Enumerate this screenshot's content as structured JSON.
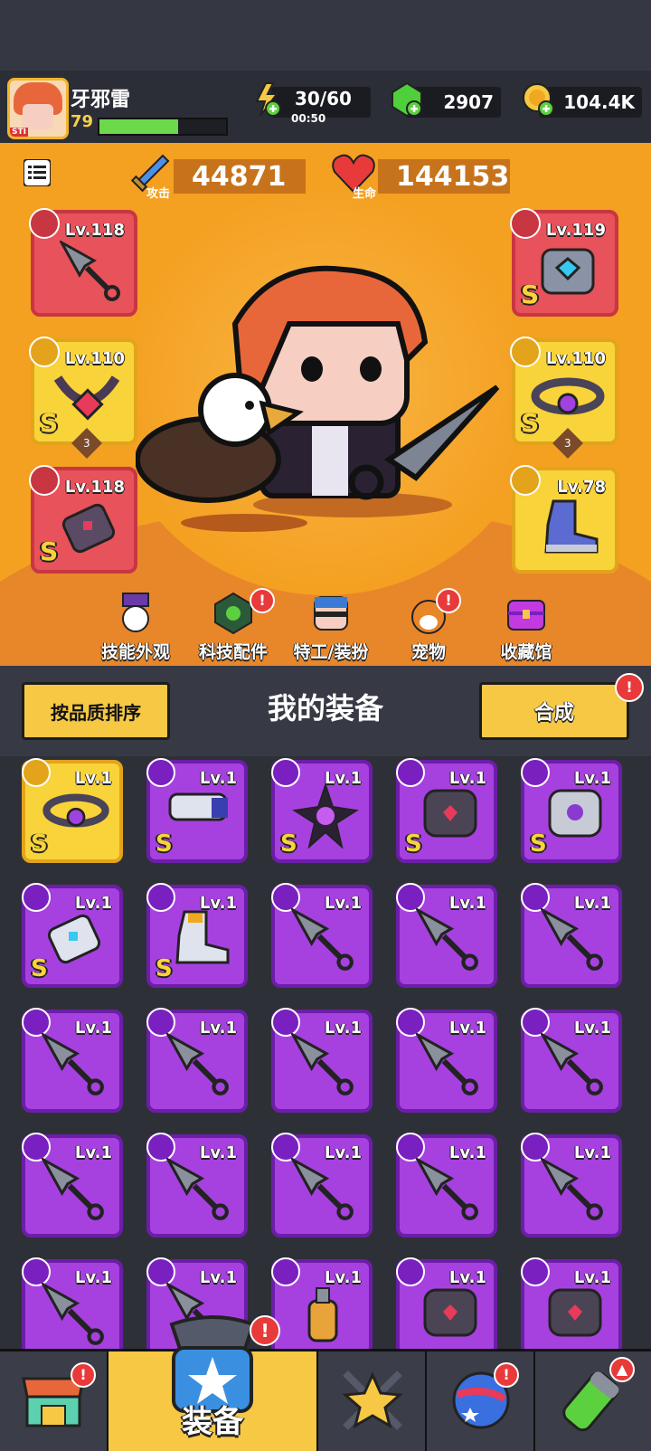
{
  "player": {
    "name": "牙邪雷",
    "level": "79",
    "avatar_tag": "STI",
    "xp_progress": 0.62
  },
  "resources": {
    "energy": "30/60",
    "energy_timer": "00:50",
    "gems": "2907",
    "coins": "104.4K"
  },
  "stats": {
    "attack_label": "攻击",
    "attack_value": "44871",
    "hp_label": "生命",
    "hp_value": "144153"
  },
  "equipped": {
    "left": [
      {
        "lv": "Lv.118",
        "rank": "",
        "stars": ""
      },
      {
        "lv": "Lv.110",
        "rank": "S",
        "stars": "3"
      },
      {
        "lv": "Lv.118",
        "rank": "S",
        "stars": ""
      }
    ],
    "right": [
      {
        "lv": "Lv.119",
        "rank": "S",
        "stars": ""
      },
      {
        "lv": "Lv.110",
        "rank": "S",
        "stars": "3"
      },
      {
        "lv": "Lv.78",
        "rank": "",
        "stars": ""
      }
    ]
  },
  "hero_menu": [
    {
      "label": "技能外观",
      "badge": ""
    },
    {
      "label": "科技配件",
      "badge": "!"
    },
    {
      "label": "特工/装扮",
      "badge": ""
    },
    {
      "label": "宠物",
      "badge": "!"
    },
    {
      "label": "收藏馆",
      "badge": ""
    }
  ],
  "equipment_panel": {
    "title": "我的装备",
    "sort_label": "按品质排序",
    "merge_label": "合成",
    "merge_badge": "!"
  },
  "inventory_level": "Lv.1",
  "inventory_rank": "S",
  "bottom_nav": {
    "equip_label": "装备",
    "badge": "!"
  },
  "colors": {
    "hero_bg": "#f4a021",
    "purple_item": "#a641e0",
    "gold_item": "#f9d33a",
    "red_slot": "#e8525a",
    "button_yellow": "#f7c843",
    "badge_red": "#e83a3a"
  }
}
